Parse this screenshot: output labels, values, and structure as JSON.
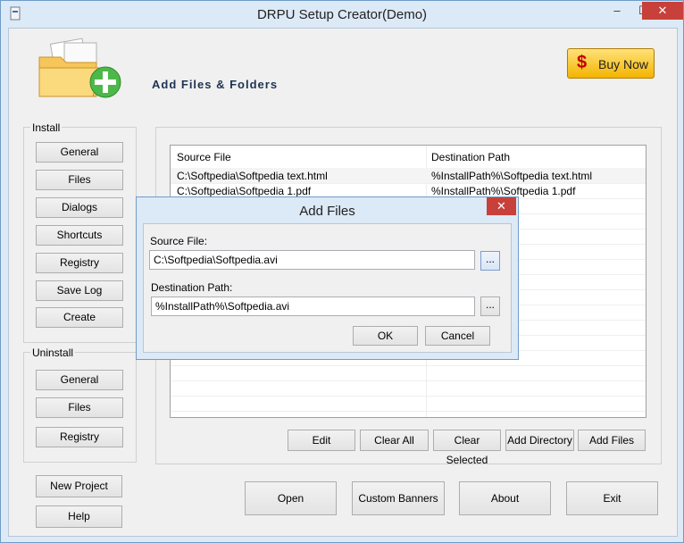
{
  "window": {
    "title": "DRPU Setup Creator(Demo)",
    "minimize": "–",
    "maximize": "☐",
    "close": "✕"
  },
  "header": {
    "title": "Add Files & Folders",
    "buy_now": "Buy Now",
    "buy_symbol": "$"
  },
  "install": {
    "label": "Install",
    "buttons": [
      "General",
      "Files",
      "Dialogs",
      "Shortcuts",
      "Registry",
      "Save Log",
      "Create"
    ]
  },
  "uninstall": {
    "label": "Uninstall",
    "buttons": [
      "General",
      "Files",
      "Registry"
    ]
  },
  "side_buttons": {
    "new_project": "New Project",
    "help": "Help"
  },
  "file_list": {
    "columns": [
      "Source File",
      "Destination Path"
    ],
    "rows": [
      {
        "source": "C:\\Softpedia\\Softpedia text.html",
        "dest": "%InstallPath%\\Softpedia text.html"
      },
      {
        "source": "C:\\Softpedia\\Softpedia 1.pdf",
        "dest": "%InstallPath%\\Softpedia 1.pdf"
      }
    ]
  },
  "list_actions": {
    "edit": "Edit",
    "clear_all": "Clear All",
    "clear_selected": "Clear Selected",
    "add_directory": "Add Directory",
    "add_files": "Add Files"
  },
  "bottom_buttons": {
    "open": "Open",
    "custom_banners": "Custom Banners",
    "about": "About",
    "exit": "Exit"
  },
  "dialog": {
    "title": "Add Files",
    "close": "✕",
    "source_label": "Source File:",
    "source_value": "C:\\Softpedia\\Softpedia.avi",
    "dest_label": "Destination Path:",
    "dest_value": "%InstallPath%\\Softpedia.avi",
    "browse": "...",
    "ok": "OK",
    "cancel": "Cancel"
  },
  "colors": {
    "accent": "#6f9cc9",
    "close": "#c7413a",
    "buy_now": "#f4b400"
  }
}
